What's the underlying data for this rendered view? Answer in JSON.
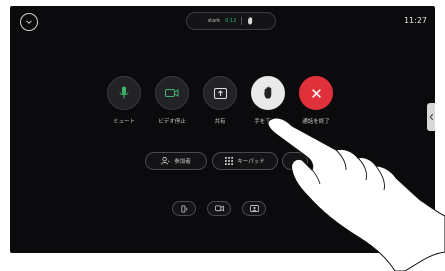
{
  "header": {
    "call_name": "stark",
    "call_timer": "0:12",
    "time": "11:27"
  },
  "actions": [
    {
      "label": "ミュート",
      "icon": "microphone-icon"
    },
    {
      "label": "ビデオ停止",
      "icon": "video-camera-icon"
    },
    {
      "label": "共有",
      "icon": "share-screen-icon"
    },
    {
      "label": "手を下げる",
      "icon": "raised-hand-icon"
    },
    {
      "label": "通話を終了",
      "icon": "end-call-icon"
    }
  ],
  "pills": {
    "participants": "参加者",
    "keypad": "キーパッド",
    "more": "…"
  },
  "colors": {
    "end_call": "#e0303a",
    "timer": "#2bb57a",
    "mic_green": "#3bb36b"
  }
}
